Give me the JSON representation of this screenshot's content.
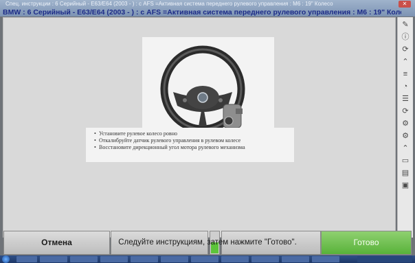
{
  "window": {
    "title": "Спец. инструкции : 6 Серийный - E63/E64 (2003 - ) : с AFS =Активная система переднего рулевого управления : M6 : 19\" Колесо"
  },
  "header": {
    "subtitle": "BMW : 6 Серийный - E63/E64 (2003 -   ) : с AFS =Активная система переднего рулевого управления : M6 : 19\" Колесо"
  },
  "illustration": {
    "icon": "steering-wheel-icon"
  },
  "instructions": [
    "Установите рулевое колесо ровно",
    "Откалибруйте датчик рулевого управления в рулевом колесе",
    "Восстановите дирекционный угол мотора рулевого механизма"
  ],
  "prompt": "Следуйте инструкциям, затем нажмите \"Готово\".",
  "buttons": {
    "cancel": "Отмена",
    "done": "Готово"
  },
  "progress": {
    "value": 0.5
  },
  "colors": {
    "done_green": "#58b23a",
    "subtitle_blue": "#1d2c88"
  }
}
